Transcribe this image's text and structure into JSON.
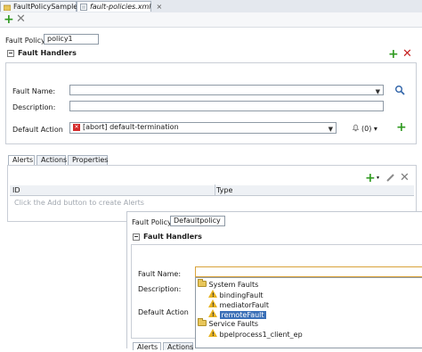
{
  "tabs": [
    {
      "label": "FaultPolicySample",
      "close": "×"
    },
    {
      "label": "fault-policies.xml",
      "close": "×"
    }
  ],
  "toolbar": {
    "add": "+",
    "delete": "✕"
  },
  "main": {
    "fault_policy_label": "Fault Policy:",
    "fault_policy_value": "policy1",
    "section_title": "Fault Handlers",
    "fault_name_label": "Fault Name:",
    "fault_name_value": "",
    "description_label": "Description:",
    "description_value": "",
    "default_action_label": "Default Action",
    "default_action_value": "[abort] default-termination",
    "count_label": "(0)",
    "subtabs": [
      "Alerts",
      "Actions",
      "Properties"
    ],
    "grid_headers": [
      "ID",
      "Type"
    ],
    "grid_empty": "Click the Add button to create Alerts"
  },
  "overlay": {
    "fault_policy_label": "Fault Policy:",
    "fault_policy_value": "Defaultpolicy",
    "section_title": "Fault Handlers",
    "fault_name_label": "Fault Name:",
    "description_label": "Description:",
    "default_action_label": "Default Action",
    "subtabs": [
      "Alerts",
      "Actions"
    ],
    "dropdown": [
      {
        "label": "System Faults",
        "kind": "folder",
        "selected": false
      },
      {
        "label": "bindingFault",
        "kind": "warn",
        "selected": false
      },
      {
        "label": "mediatorFault",
        "kind": "warn",
        "selected": false
      },
      {
        "label": "remoteFault",
        "kind": "warn",
        "selected": true
      },
      {
        "label": "Service Faults",
        "kind": "folder",
        "selected": false
      },
      {
        "label": "bpelprocess1_client_ep",
        "kind": "warn",
        "selected": false
      }
    ]
  },
  "colors": {
    "add_green": "#2f9a20",
    "delete_red": "#c62222",
    "selection": "#3a6fb7"
  }
}
